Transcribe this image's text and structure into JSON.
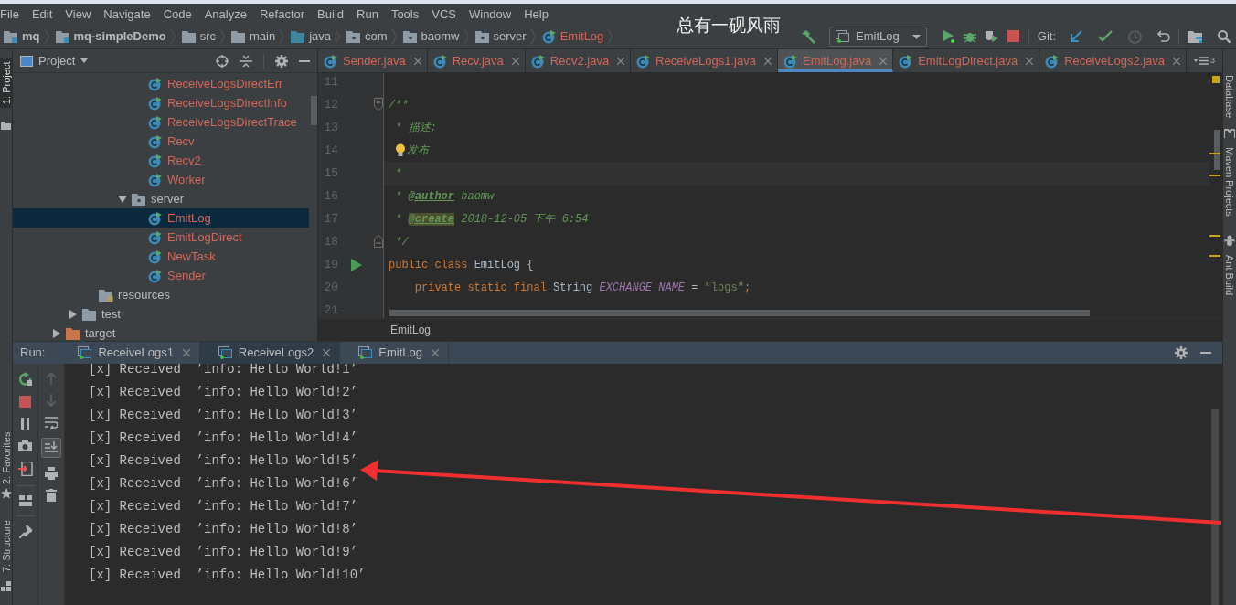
{
  "menu": [
    "File",
    "Edit",
    "View",
    "Navigate",
    "Code",
    "Analyze",
    "Refactor",
    "Build",
    "Run",
    "Tools",
    "VCS",
    "Window",
    "Help"
  ],
  "caption": "总有一砚风雨",
  "breadcrumbs": [
    {
      "label": "mq",
      "kind": "module"
    },
    {
      "label": "mq-simpleDemo",
      "kind": "module"
    },
    {
      "label": "src",
      "kind": "folder"
    },
    {
      "label": "main",
      "kind": "folder"
    },
    {
      "label": "java",
      "kind": "source"
    },
    {
      "label": "com",
      "kind": "package"
    },
    {
      "label": "baomw",
      "kind": "package"
    },
    {
      "label": "server",
      "kind": "package"
    },
    {
      "label": "EmitLog",
      "kind": "class"
    }
  ],
  "run_config": "EmitLog",
  "git_label": "Git:",
  "side_tools_left": [
    {
      "label": "1: Project",
      "selected": true
    },
    {
      "label": "2: Favorites",
      "selected": false
    },
    {
      "label": "7: Structure",
      "selected": false
    }
  ],
  "side_tools_right": [
    "Database",
    "Maven Projects",
    "Ant Build"
  ],
  "project_panel": {
    "title": "Project",
    "tree": [
      {
        "label": "ReceiveLogsDirectErr",
        "kind": "class",
        "selected": false
      },
      {
        "label": "ReceiveLogsDirectInfo",
        "kind": "class",
        "selected": false
      },
      {
        "label": "ReceiveLogsDirectTrace",
        "kind": "class",
        "selected": false
      },
      {
        "label": "Recv",
        "kind": "class",
        "selected": false
      },
      {
        "label": "Recv2",
        "kind": "class",
        "selected": false
      },
      {
        "label": "Worker",
        "kind": "class",
        "selected": false
      },
      {
        "label": "server",
        "kind": "package",
        "selected": false,
        "expanded": true,
        "children": [
          {
            "label": "EmitLog",
            "kind": "class",
            "selected": true
          },
          {
            "label": "EmitLogDirect",
            "kind": "class",
            "selected": false
          },
          {
            "label": "NewTask",
            "kind": "class",
            "selected": false
          },
          {
            "label": "Sender",
            "kind": "class",
            "selected": false
          }
        ]
      },
      {
        "label": "resources",
        "kind": "resources",
        "selected": false
      },
      {
        "label": "test",
        "kind": "folder",
        "selected": false,
        "expanded": false
      },
      {
        "label": "target",
        "kind": "excluded",
        "selected": false,
        "expanded": false
      }
    ]
  },
  "editor_tabs": [
    {
      "label": "Sender.java",
      "selected": false
    },
    {
      "label": "Recv.java",
      "selected": false
    },
    {
      "label": "Recv2.java",
      "selected": false
    },
    {
      "label": "ReceiveLogs1.java",
      "selected": false
    },
    {
      "label": "EmitLog.java",
      "selected": true
    },
    {
      "label": "EmitLogDirect.java",
      "selected": false
    },
    {
      "label": "ReceiveLogs2.java",
      "selected": false
    }
  ],
  "tab_overflow": "3",
  "code": [
    {
      "number": "11"
    },
    {
      "number": "12",
      "fold_open": true,
      "segments": [
        {
          "kind": "comment",
          "text": "/**"
        }
      ]
    },
    {
      "number": "13",
      "segments": [
        {
          "kind": "comment",
          "text": " * 描述:"
        }
      ]
    },
    {
      "number": "14",
      "bulb": true,
      "segments": [
        {
          "kind": "comment",
          "text": "发布"
        }
      ]
    },
    {
      "number": "15",
      "current": true,
      "segments": [
        {
          "kind": "comment",
          "text": " *"
        }
      ]
    },
    {
      "number": "16",
      "segments": [
        {
          "kind": "comment",
          "text": " * "
        },
        {
          "kind": "tag",
          "text": "@author"
        },
        {
          "kind": "comment",
          "text": " baomw"
        }
      ]
    },
    {
      "number": "17",
      "segments": [
        {
          "kind": "comment",
          "text": " * "
        },
        {
          "kind": "tag_marked",
          "text": "@create"
        },
        {
          "kind": "comment",
          "text": " 2018-12-05 下午 6:54"
        }
      ]
    },
    {
      "number": "18",
      "fold_close": true,
      "segments": [
        {
          "kind": "comment",
          "text": " */"
        }
      ]
    },
    {
      "number": "19",
      "run_marker": true,
      "segments": [
        {
          "kind": "keyword",
          "text": "public class "
        },
        {
          "kind": "plain",
          "text": "EmitLog {"
        }
      ]
    },
    {
      "number": "20",
      "segments": [
        {
          "kind": "keyword",
          "text": "    private static final "
        },
        {
          "kind": "plain",
          "text": "String "
        },
        {
          "kind": "constant",
          "text": "EXCHANGE_NAME"
        },
        {
          "kind": "plain",
          "text": " = "
        },
        {
          "kind": "string",
          "text": "\"logs\""
        },
        {
          "kind": "keyword",
          "text": ";"
        }
      ]
    },
    {
      "number": "21"
    }
  ],
  "editor_breadcrumb": "EmitLog",
  "run_panel": {
    "title": "Run:",
    "tabs": [
      {
        "label": "ReceiveLogs1",
        "selected": false
      },
      {
        "label": "ReceiveLogs2",
        "selected": true
      },
      {
        "label": "EmitLog",
        "selected": false
      }
    ],
    "output": [
      "[x] Received  ’info: Hello World!1’",
      "[x] Received  ’info: Hello World!2’",
      "[x] Received  ’info: Hello World!3’",
      "[x] Received  ’info: Hello World!4’",
      "[x] Received  ’info: Hello World!5’",
      "[x] Received  ’info: Hello World!6’",
      "[x] Received  ’info: Hello World!7’",
      "[x] Received  ’info: Hello World!8’",
      "[x] Received  ’info: Hello World!9’",
      "[x] Received  ’info: Hello World!10’"
    ]
  }
}
